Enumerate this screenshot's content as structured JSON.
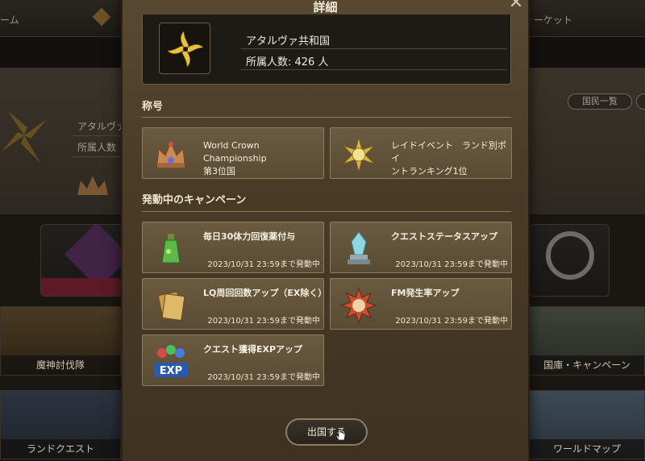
{
  "background": {
    "nav_left": "ーム",
    "nav_right": "ーケット",
    "nation_name_partial": "アタルヴァ",
    "nation_count_partial": "所属人数",
    "button_citizens": "国民一覧",
    "card_raid": "魔神討伐隊",
    "card_store": "国庫・キャンペーン",
    "card_land_quest": "ランドクエスト",
    "card_world_map": "ワールドマップ"
  },
  "modal": {
    "title": "詳細",
    "close_icon": "close-icon",
    "nation": {
      "name": "アタルヴァ共和国",
      "member_count": "所属人数: 426 人",
      "emblem_icon": "gold-star-emblem-icon"
    },
    "titles_section": {
      "heading": "称号",
      "items": [
        {
          "icon": "crown-icon",
          "text_line1": "World Crown Championship",
          "text_line2": "第3位国"
        },
        {
          "icon": "gold-star-medal-icon",
          "text_line1": "レイドイベント　ランド別ポイ",
          "text_line2": "ントランキング1位"
        }
      ]
    },
    "campaign_section": {
      "heading": "発動中のキャンペーン",
      "items": [
        {
          "icon": "green-potion-icon",
          "title": "毎日30体力回復薬付与",
          "until": "2023/10/31 23:59まで発動中"
        },
        {
          "icon": "crystal-pedestal-icon",
          "title": "クエストステータスアップ",
          "until": "2023/10/31 23:59まで発動中"
        },
        {
          "icon": "cards-icon",
          "title": "LQ周回回数アップ（EX除く）",
          "until": "2023/10/31 23:59まで発動中"
        },
        {
          "icon": "red-gear-emblem-icon",
          "title": "FM発生率アップ",
          "until": "2023/10/31 23:59まで発動中"
        },
        {
          "icon": "exp-orbs-icon",
          "title": "クエスト獲得EXPアップ",
          "until": "2023/10/31 23:59まで発動中",
          "icon_text": "EXP"
        }
      ]
    },
    "depart_button": "出国する"
  }
}
